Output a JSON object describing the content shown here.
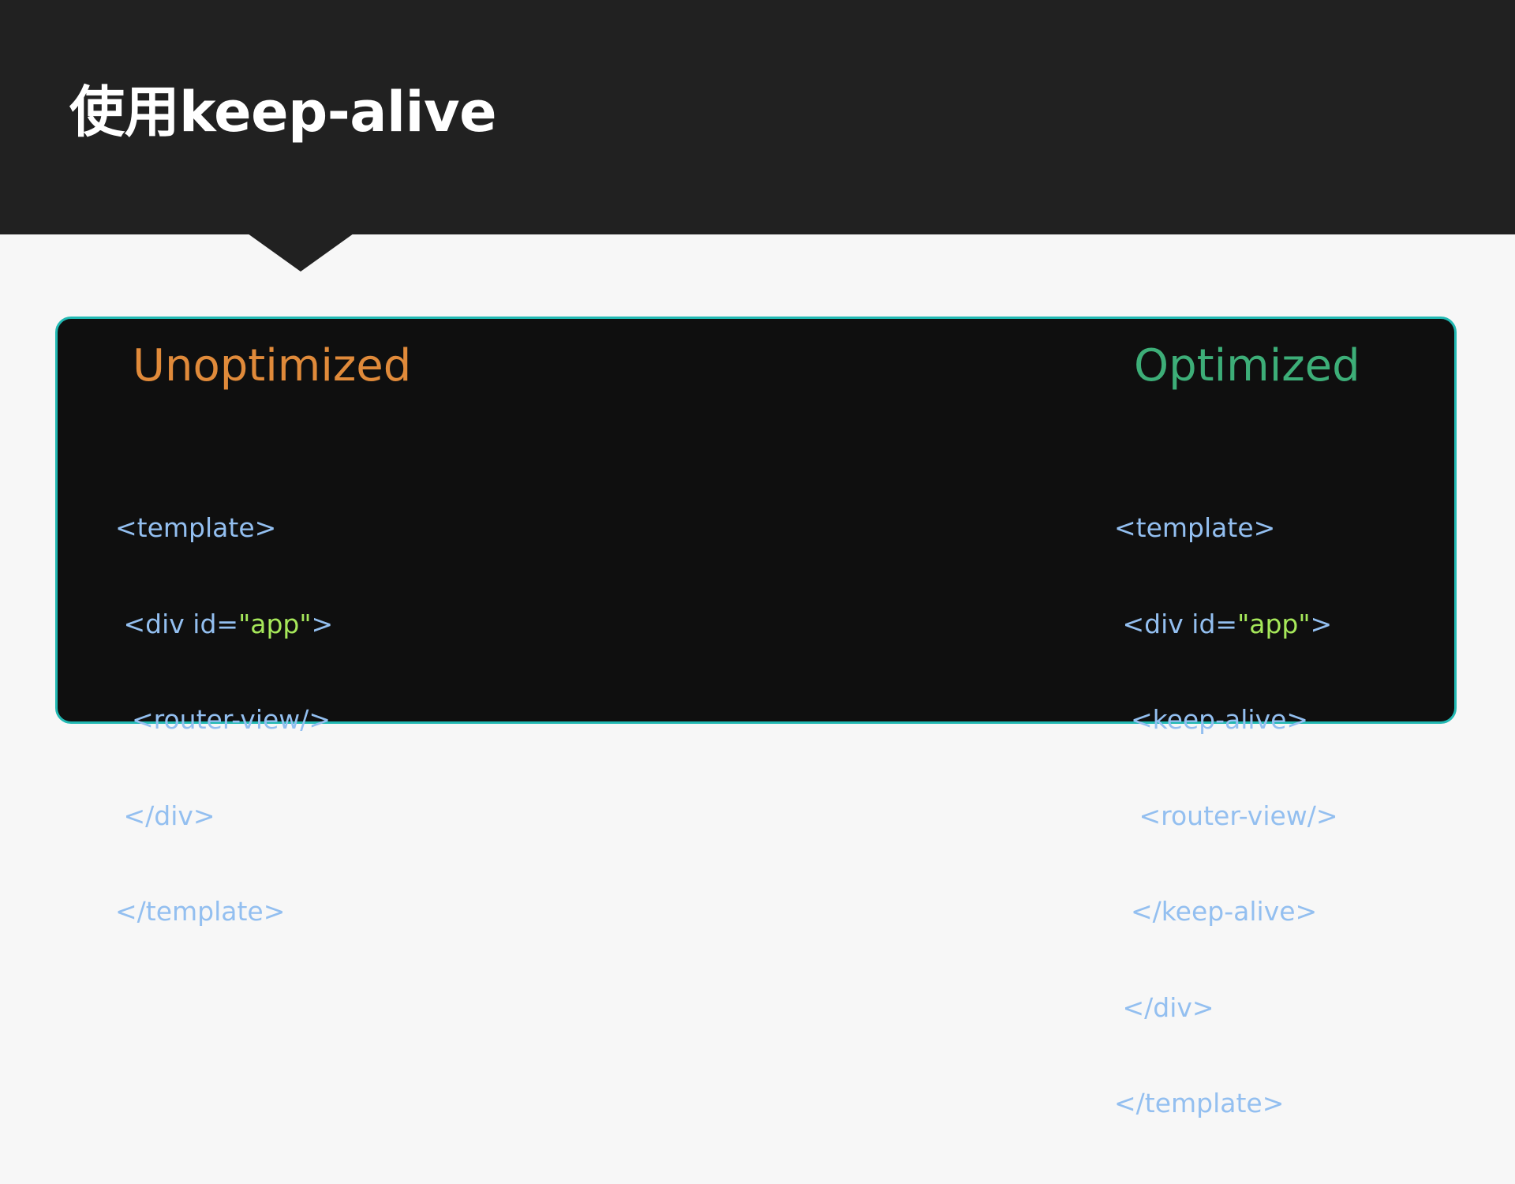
{
  "slide": {
    "title": "使用keep-alive"
  },
  "comparison": {
    "unoptimized": {
      "heading": "Unoptimized",
      "heading_color": "#e08a3a",
      "code_lines": [
        {
          "indent": "",
          "pre": "<template>",
          "str": "",
          "post": ""
        },
        {
          "indent": " ",
          "pre": "<div id=",
          "str": "\"app\"",
          "post": ">"
        },
        {
          "indent": "  ",
          "pre": "<router-view/>",
          "str": "",
          "post": ""
        },
        {
          "indent": " ",
          "pre": "</div>",
          "str": "",
          "post": ""
        },
        {
          "indent": "",
          "pre": "</template>",
          "str": "",
          "post": ""
        }
      ]
    },
    "optimized": {
      "heading": "Optimized",
      "heading_color": "#3dae78",
      "code_lines": [
        {
          "indent": "",
          "pre": "<template>",
          "str": "",
          "post": ""
        },
        {
          "indent": " ",
          "pre": "<div id=",
          "str": "\"app\"",
          "post": ">"
        },
        {
          "indent": "  ",
          "pre": "<keep-alive>",
          "str": "",
          "post": ""
        },
        {
          "indent": "   ",
          "pre": "<router-view/>",
          "str": "",
          "post": ""
        },
        {
          "indent": "  ",
          "pre": "</keep-alive>",
          "str": "",
          "post": ""
        },
        {
          "indent": " ",
          "pre": "</div>",
          "str": "",
          "post": ""
        },
        {
          "indent": "",
          "pre": "</template>",
          "str": "",
          "post": ""
        }
      ]
    }
  },
  "colors": {
    "header_bg": "#212121",
    "panel_bg": "#0f0f0f",
    "panel_border": "#22b9b3",
    "code_tag": "#93bff0",
    "code_string": "#a6e85a"
  }
}
